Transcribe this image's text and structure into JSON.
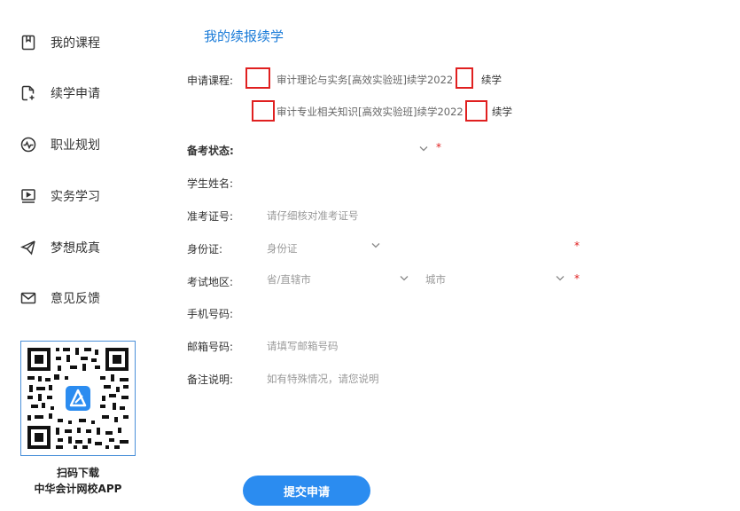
{
  "sidebar": {
    "items": [
      {
        "label": "我的课程",
        "icon": "bookmark-icon"
      },
      {
        "label": "续学申请",
        "icon": "file-add-icon"
      },
      {
        "label": "职业规划",
        "icon": "pulse-icon"
      },
      {
        "label": "实务学习",
        "icon": "monitor-icon"
      },
      {
        "label": "梦想成真",
        "icon": "send-icon"
      },
      {
        "label": "意见反馈",
        "icon": "mail-icon"
      }
    ],
    "qr_caption_line1": "扫码下载",
    "qr_caption_line2": "中华会计网校APP"
  },
  "main": {
    "title": "我的续报续学",
    "course_label": "申请课程:",
    "courses": [
      {
        "name": "审计理论与实务[高效实验班]续学2022",
        "badge": "续学"
      },
      {
        "name": "审计专业相关知识[高效实验班]续学2022",
        "badge": "续学"
      }
    ],
    "fields": {
      "status_label": "备考状态:",
      "student_name_label": "学生姓名:",
      "ticket_label": "准考证号:",
      "ticket_placeholder": "请仔细核对准考证号",
      "id_label": "身份证:",
      "id_placeholder": "身份证",
      "region_label": "考试地区:",
      "province_placeholder": "省/直辖市",
      "city_placeholder": "城市",
      "phone_label": "手机号码:",
      "email_label": "邮箱号码:",
      "email_placeholder": "请填写邮箱号码",
      "note_label": "备注说明:",
      "note_placeholder": "如有特殊情况，请您说明",
      "required_mark": "*"
    },
    "submit_label": "提交申请"
  },
  "colors": {
    "accent": "#2b8cf0",
    "title_blue": "#1a7bd8",
    "required_red": "#e02020"
  }
}
